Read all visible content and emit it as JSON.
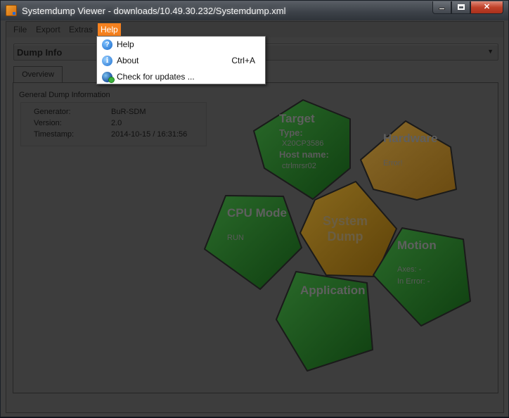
{
  "window": {
    "title": "Systemdump Viewer - downloads/10.49.30.232/Systemdump.xml"
  },
  "menubar": {
    "items": [
      "File",
      "Export",
      "Extras",
      "Help"
    ],
    "active": "Help"
  },
  "help_menu": {
    "items": [
      {
        "label": "Help",
        "shortcut": "",
        "icon": "help-icon"
      },
      {
        "label": "About",
        "shortcut": "Ctrl+A",
        "icon": "info-icon"
      },
      {
        "label": "Check for updates ...",
        "shortcut": "",
        "icon": "globe-update-icon"
      }
    ]
  },
  "view_selector": {
    "value": "Dump Info"
  },
  "tabs": [
    "Overview"
  ],
  "overview": {
    "section_title": "General Dump Information",
    "rows": [
      {
        "key": "Generator:",
        "value": "BuR-SDM"
      },
      {
        "key": "Version:",
        "value": "2.0"
      },
      {
        "key": "Timestamp:",
        "value": "2014-10-15 / 16:31:56"
      }
    ]
  },
  "diagram": {
    "center": {
      "line1": "System",
      "line2": "Dump"
    },
    "target": {
      "title": "Target",
      "type_label": "Type:",
      "type_value": "X20CP3586",
      "host_label": "Host name:",
      "host_value": "ctrlmrsr02"
    },
    "hardware": {
      "title": "Hardware",
      "status": "Error!"
    },
    "cpu_mode": {
      "title": "CPU Mode",
      "value": "RUN"
    },
    "motion": {
      "title": "Motion",
      "axes": "Axes: -",
      "in_error": "In Error: -"
    },
    "application": {
      "title": "Application"
    },
    "colors": {
      "green": "#1f7a1f",
      "orange": "#c7770f",
      "center": "#d08a12"
    }
  }
}
